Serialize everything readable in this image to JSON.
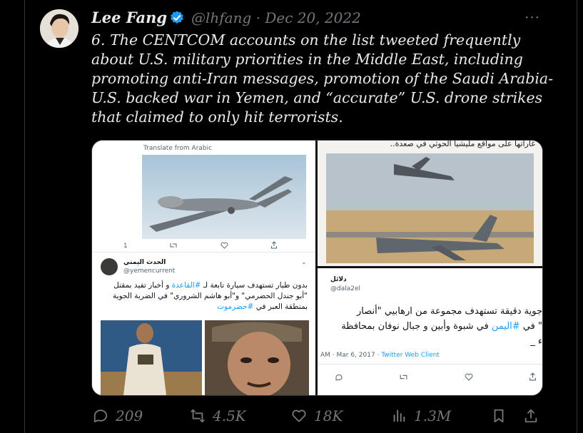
{
  "tweet": {
    "author_name": "Lee Fang",
    "handle_date": "@lhfang · Dec 20, 2022",
    "text": "6. The CENTCOM accounts on the list tweeted frequently about U.S. military priorities in the Middle East, including promoting anti-Iran messages, promotion of the Saudi Arabia-U.S. backed war in Yemen, and “accurate” U.S. drone strikes that claimed to only hit terrorists.",
    "more_label": "···"
  },
  "media": {
    "panel1": {
      "translate_label": "Translate from Arabic",
      "reply_count": "1",
      "account_name": "الحدث اليمني",
      "account_handle": "@yemencurrent",
      "body_prefix": "بدون طيار تستهدف سيارة تابعة لـ",
      "hashtag1": "#القاعدة",
      "body_mid": "و أخبار تفيد بمقتل \"أبو جندل الحضرمي\" و\"أبو هاشم الشروري\" في الضربة الجوية بمنطقة العبر في",
      "hashtag2": "#حضرموت"
    },
    "panel2": {
      "caption": "غاراتها على مواقع مليشيا الحوثي في صعدة.."
    },
    "panel3": {
      "account_name": "دلائل",
      "account_handle": "@dala2el",
      "line1": "جوية دقيقة تستهدف مجموعة من ارهابيي \"أنصار",
      "line2_prefix": "\" في",
      "hashtag": "#اليمن",
      "line2_suffix": "في شبوة وأبين و جبال نوفان بمحافظة",
      "line3": "ء _",
      "timestamp": "AM · Mar 6, 2017 · ",
      "client": "Twitter Web Client"
    }
  },
  "actions": {
    "replies": "209",
    "retweets": "4.5K",
    "likes": "18K",
    "views": "1.3M"
  },
  "colors": {
    "background": "#000000",
    "text": "#e7e9ea",
    "muted": "#71767b",
    "verified": "#1d9bf0"
  }
}
